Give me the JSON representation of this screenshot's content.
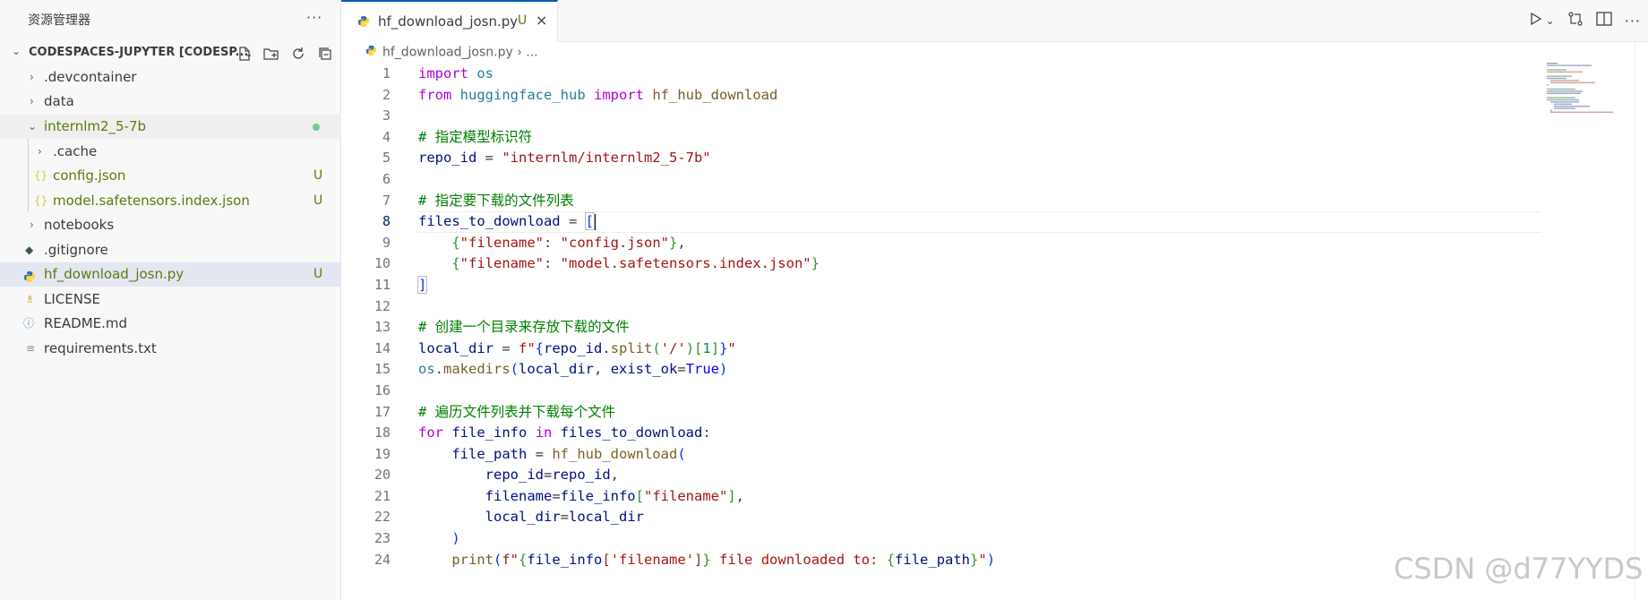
{
  "explorer": {
    "title": "资源管理器",
    "more": "···",
    "workspace": "CODESPACES-JUPYTER [CODESP...",
    "items": [
      {
        "label": ".devcontainer",
        "type": "folder",
        "expanded": false,
        "badge": ""
      },
      {
        "label": "data",
        "type": "folder",
        "expanded": false,
        "badge": ""
      },
      {
        "label": "internlm2_5-7b",
        "type": "folder",
        "expanded": true,
        "badge": "dot"
      },
      {
        "label": ".cache",
        "type": "folder",
        "expanded": false,
        "badge": ""
      },
      {
        "label": "config.json",
        "type": "json",
        "badge": "U"
      },
      {
        "label": "model.safetensors.index.json",
        "type": "json",
        "badge": "U"
      },
      {
        "label": "notebooks",
        "type": "folder",
        "expanded": false,
        "badge": ""
      },
      {
        "label": ".gitignore",
        "type": "git",
        "badge": ""
      },
      {
        "label": "hf_download_josn.py",
        "type": "python",
        "badge": "U"
      },
      {
        "label": "LICENSE",
        "type": "license",
        "badge": ""
      },
      {
        "label": "README.md",
        "type": "info",
        "badge": ""
      },
      {
        "label": "requirements.txt",
        "type": "text",
        "badge": ""
      }
    ]
  },
  "editor": {
    "tab_label": "hf_download_josn.py",
    "tab_badge": "U",
    "tab_close": "×",
    "breadcrumb_file": "hf_download_josn.py",
    "breadcrumb_rest": " › ...",
    "current_line": 8,
    "line_numbers": [
      "1",
      "2",
      "3",
      "4",
      "5",
      "6",
      "7",
      "8",
      "9",
      "10",
      "11",
      "12",
      "13",
      "14",
      "15",
      "16",
      "17",
      "18",
      "19",
      "20",
      "21",
      "22",
      "23",
      "24"
    ],
    "lines": [
      [
        {
          "t": "import",
          "c": "kw"
        },
        {
          "t": " "
        },
        {
          "t": "os",
          "c": "cls"
        }
      ],
      [
        {
          "t": "from",
          "c": "kw"
        },
        {
          "t": " "
        },
        {
          "t": "huggingface_hub",
          "c": "cls"
        },
        {
          "t": " "
        },
        {
          "t": "import",
          "c": "kw"
        },
        {
          "t": " "
        },
        {
          "t": "hf_hub_download",
          "c": "fn"
        }
      ],
      [],
      [
        {
          "t": "# 指定模型标识符",
          "c": "com"
        }
      ],
      [
        {
          "t": "repo_id",
          "c": "var"
        },
        {
          "t": " = "
        },
        {
          "t": "\"internlm/internlm2_5-7b\"",
          "c": "str"
        }
      ],
      [],
      [
        {
          "t": "# 指定要下载的文件列表",
          "c": "com"
        }
      ],
      [
        {
          "t": "files_to_download",
          "c": "var"
        },
        {
          "t": " = "
        },
        {
          "t": "[",
          "c": "br1",
          "bm": true
        },
        {
          "t": "",
          "caret": true
        }
      ],
      [
        {
          "t": "    "
        },
        {
          "t": "{",
          "c": "br2"
        },
        {
          "t": "\"filename\"",
          "c": "str"
        },
        {
          "t": ": "
        },
        {
          "t": "\"config.json\"",
          "c": "str"
        },
        {
          "t": "}",
          "c": "br2"
        },
        {
          "t": ","
        }
      ],
      [
        {
          "t": "    "
        },
        {
          "t": "{",
          "c": "br2"
        },
        {
          "t": "\"filename\"",
          "c": "str"
        },
        {
          "t": ": "
        },
        {
          "t": "\"model.safetensors.index.json\"",
          "c": "str"
        },
        {
          "t": "}",
          "c": "br2"
        }
      ],
      [
        {
          "t": "]",
          "c": "br1",
          "bm": true
        }
      ],
      [],
      [
        {
          "t": "# 创建一个目录来存放下载的文件",
          "c": "com"
        }
      ],
      [
        {
          "t": "local_dir",
          "c": "var"
        },
        {
          "t": " = "
        },
        {
          "t": "f\"",
          "c": "str"
        },
        {
          "t": "{",
          "c": "br1"
        },
        {
          "t": "repo_id",
          "c": "var"
        },
        {
          "t": "."
        },
        {
          "t": "split",
          "c": "fn"
        },
        {
          "t": "(",
          "c": "br2"
        },
        {
          "t": "'/'",
          "c": "str"
        },
        {
          "t": ")",
          "c": "br2"
        },
        {
          "t": "[",
          "c": "br2"
        },
        {
          "t": "1",
          "c": "num"
        },
        {
          "t": "]",
          "c": "br2"
        },
        {
          "t": "}",
          "c": "br1"
        },
        {
          "t": "\"",
          "c": "str"
        }
      ],
      [
        {
          "t": "os",
          "c": "cls"
        },
        {
          "t": "."
        },
        {
          "t": "makedirs",
          "c": "fn"
        },
        {
          "t": "(",
          "c": "br1"
        },
        {
          "t": "local_dir",
          "c": "var"
        },
        {
          "t": ", "
        },
        {
          "t": "exist_ok",
          "c": "var"
        },
        {
          "t": "="
        },
        {
          "t": "True",
          "c": "const"
        },
        {
          "t": ")",
          "c": "br1"
        }
      ],
      [],
      [
        {
          "t": "# 遍历文件列表并下载每个文件",
          "c": "com"
        }
      ],
      [
        {
          "t": "for",
          "c": "kw"
        },
        {
          "t": " "
        },
        {
          "t": "file_info",
          "c": "var"
        },
        {
          "t": " "
        },
        {
          "t": "in",
          "c": "kw"
        },
        {
          "t": " "
        },
        {
          "t": "files_to_download",
          "c": "var"
        },
        {
          "t": ":"
        }
      ],
      [
        {
          "t": "    "
        },
        {
          "t": "file_path",
          "c": "var"
        },
        {
          "t": " = "
        },
        {
          "t": "hf_hub_download",
          "c": "fn"
        },
        {
          "t": "(",
          "c": "br1"
        }
      ],
      [
        {
          "t": "        "
        },
        {
          "t": "repo_id",
          "c": "var"
        },
        {
          "t": "="
        },
        {
          "t": "repo_id",
          "c": "var"
        },
        {
          "t": ","
        }
      ],
      [
        {
          "t": "        "
        },
        {
          "t": "filename",
          "c": "var"
        },
        {
          "t": "="
        },
        {
          "t": "file_info",
          "c": "var"
        },
        {
          "t": "[",
          "c": "br2"
        },
        {
          "t": "\"filename\"",
          "c": "str"
        },
        {
          "t": "]",
          "c": "br2"
        },
        {
          "t": ","
        }
      ],
      [
        {
          "t": "        "
        },
        {
          "t": "local_dir",
          "c": "var"
        },
        {
          "t": "="
        },
        {
          "t": "local_dir",
          "c": "var"
        }
      ],
      [
        {
          "t": "    "
        },
        {
          "t": ")",
          "c": "br1"
        }
      ],
      [
        {
          "t": "    "
        },
        {
          "t": "print",
          "c": "fn"
        },
        {
          "t": "(",
          "c": "br1"
        },
        {
          "t": "f\"",
          "c": "str"
        },
        {
          "t": "{",
          "c": "br2"
        },
        {
          "t": "file_info",
          "c": "var"
        },
        {
          "t": "[",
          "c": "br3"
        },
        {
          "t": "'filename'",
          "c": "str"
        },
        {
          "t": "]",
          "c": "br3"
        },
        {
          "t": "}",
          "c": "br2"
        },
        {
          "t": " file downloaded to: ",
          "c": "str"
        },
        {
          "t": "{",
          "c": "br2"
        },
        {
          "t": "file_path",
          "c": "var"
        },
        {
          "t": "}",
          "c": "br2"
        },
        {
          "t": "\"",
          "c": "str"
        },
        {
          "t": ")",
          "c": "br1"
        }
      ]
    ]
  },
  "watermark": "CSDN @d77YYDS",
  "colors": {
    "accent": "#005fb8",
    "untracked": "#587c0c",
    "selection": "#e4e6f1"
  }
}
